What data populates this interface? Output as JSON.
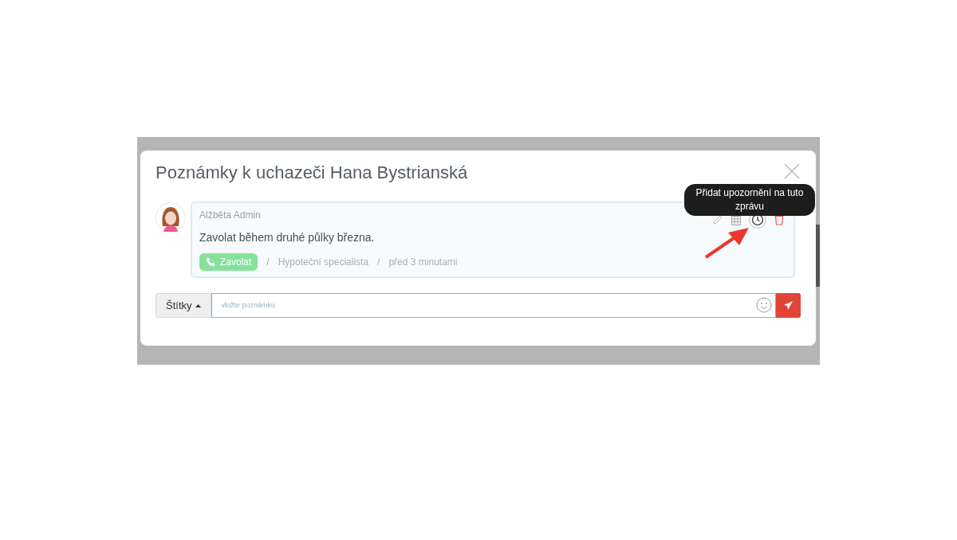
{
  "dialog": {
    "title": "Poznámky k uchazeči Hana Bystrianská"
  },
  "tooltip": "Přidat upozornění na tuto zprávu",
  "note": {
    "author": "Alžběta Admin",
    "text": "Zavolat během druhé půlky března.",
    "tag": {
      "label": "Zavolat",
      "color": "#86e29b"
    },
    "position": "Hypoteční specialista",
    "time": "před 3 minutami",
    "separator": "/"
  },
  "composer": {
    "tags_button": "Štítky",
    "placeholder": "vložte poznámku"
  }
}
